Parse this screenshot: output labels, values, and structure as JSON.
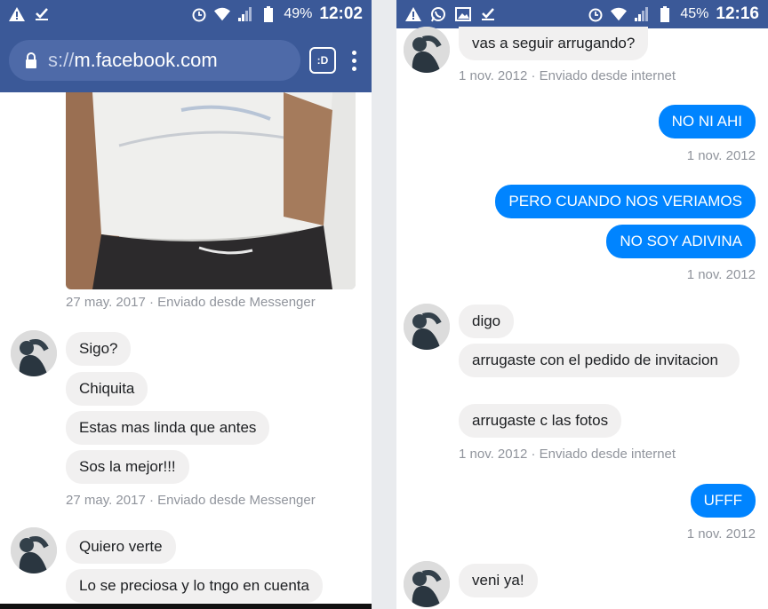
{
  "left": {
    "status": {
      "battery": "49%",
      "time": "12:02"
    },
    "url": {
      "scheme": "s://",
      "host": "m.facebook.com"
    },
    "tabs_icon": ":D",
    "photo_meta": "27 may. 2017 · Enviado desde Messenger",
    "group1": [
      "Sigo?",
      "Chiquita",
      "Estas mas linda que antes",
      "Sos la mejor!!!"
    ],
    "group1_meta": "27 may. 2017 · Enviado desde Messenger",
    "group2": [
      "Quiero verte",
      "Lo se preciosa y lo tngo en cuenta"
    ]
  },
  "right": {
    "status": {
      "battery": "45%",
      "time": "12:16"
    },
    "msg_top": "vas a seguir arrugando?",
    "meta_top": "1 nov. 2012 · Enviado desde internet",
    "out1": "NO NI AHI",
    "out1_meta": "1 nov. 2012",
    "out2": "PERO CUANDO NOS VERIAMOS",
    "out3": "NO SOY ADIVINA",
    "out23_meta": "1 nov. 2012",
    "in_group": [
      "digo",
      "arrugaste con el pedido de invitacion",
      "arrugaste c las fotos"
    ],
    "in_group_meta": "1 nov. 2012 · Enviado desde internet",
    "out4": "UFFF",
    "out4_meta": "1 nov. 2012",
    "in_last": "veni ya!"
  }
}
